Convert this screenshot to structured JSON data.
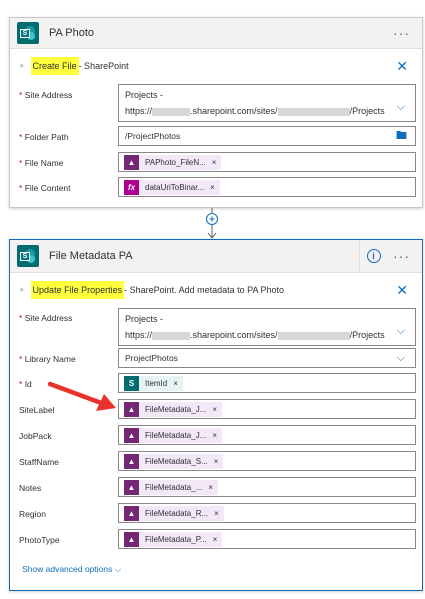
{
  "card1": {
    "title": "PA Photo",
    "more": "···",
    "action_highlight": "Create File",
    "action_rest": " - SharePoint",
    "fields": [
      {
        "label": "Site Address",
        "line1": "Projects -",
        "line2_prefix": "https://",
        "line2_mid": ".sharepoint.com/sites/",
        "line2_suffix": "/Projects"
      },
      {
        "label": "Folder Path",
        "value": "/ProjectPhotos"
      },
      {
        "label": "File Name",
        "token": "PAPhoto_FileN...",
        "token_icon": "dataverse-icon"
      },
      {
        "label": "File Content",
        "token": "dataUriToBinar...",
        "token_icon": "fx-icon"
      }
    ]
  },
  "card2": {
    "title": "File Metadata PA",
    "more": "···",
    "info": "i",
    "action_highlight": "Update File Properties",
    "action_rest": " - SharePoint. Add metadata to PA Photo",
    "fields": [
      {
        "label": "Site Address",
        "line1": "Projects -",
        "line2_prefix": "https://",
        "line2_mid": ".sharepoint.com/sites/",
        "line2_suffix": "/Projects"
      },
      {
        "label": "Library Name",
        "value": "ProjectPhotos"
      },
      {
        "label": "Id",
        "token": "ItemId"
      },
      {
        "label": "SiteLabel",
        "token": "FileMetadata_J..."
      },
      {
        "label": "JobPack",
        "token": "FileMetadata_J..."
      },
      {
        "label": "StaffName",
        "token": "FileMetadata_S..."
      },
      {
        "label": "Notes",
        "token": "FileMetadata_..."
      },
      {
        "label": "Region",
        "token": "FileMetadata_R..."
      },
      {
        "label": "PhotoType",
        "token": "FileMetadata_P..."
      }
    ],
    "advanced": "Show advanced options"
  },
  "symbols": {
    "required": "*",
    "remove": "×",
    "close": "✕",
    "chevron": "⌵",
    "fx": "fx",
    "sp_letter": "S"
  },
  "colors": {
    "accent": "#0f6cbd",
    "highlight": "#ffff3d",
    "annotation_arrow": "#e8322b",
    "sharepoint": "#036c70",
    "dataverse": "#742774"
  }
}
